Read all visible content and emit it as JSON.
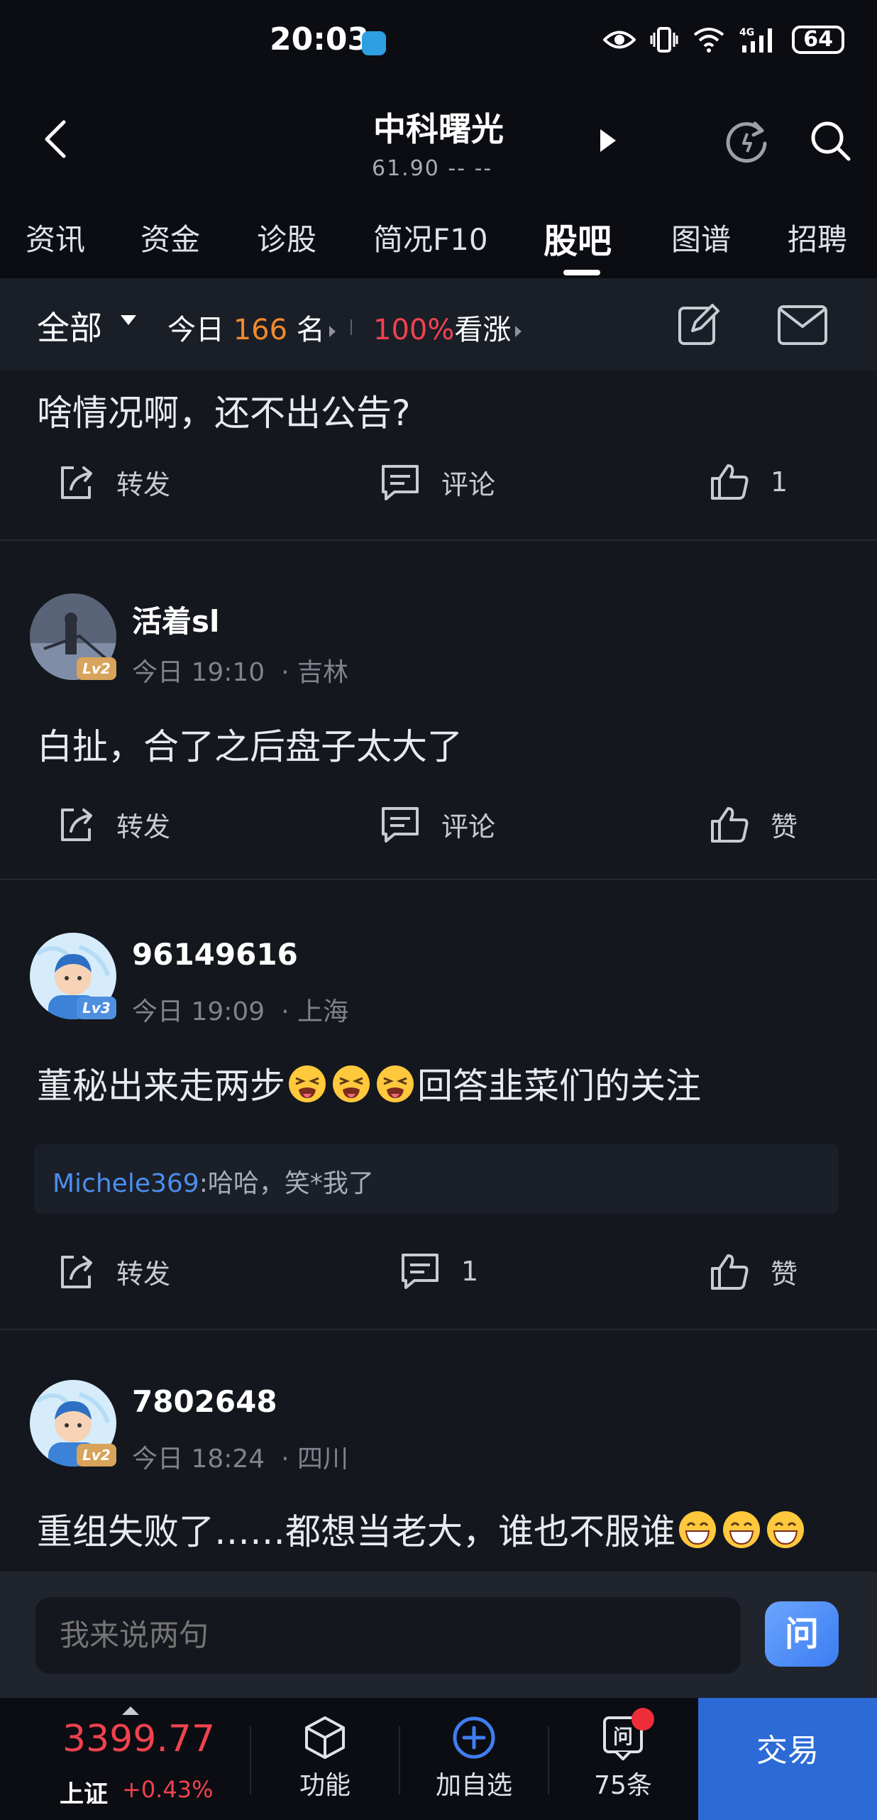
{
  "status_bar": {
    "time": "20:03",
    "battery": "64"
  },
  "header": {
    "stock_name": "中科曙光",
    "price_line": "61.90  --  --"
  },
  "tabs": [
    {
      "label": "资讯"
    },
    {
      "label": "资金"
    },
    {
      "label": "诊股"
    },
    {
      "label": "简况F10"
    },
    {
      "label": "股吧",
      "active": true
    },
    {
      "label": "图谱"
    },
    {
      "label": "招聘"
    }
  ],
  "filter": {
    "scope": "全部",
    "today_prefix": "今日",
    "today_count": "166",
    "today_suffix": "名",
    "bull_pct": "100%",
    "bull_label": "看涨"
  },
  "labels": {
    "forward": "转发",
    "comment": "评论",
    "like": "赞"
  },
  "posts": [
    {
      "content": "啥情况啊，还不出公告?",
      "comments": "评论",
      "likes": "1"
    },
    {
      "username": "活着sl",
      "level": "Lv2",
      "time": "今日 19:10",
      "location": "· 吉林",
      "content": "白扯，合了之后盘子太大了",
      "comments": "评论",
      "likes": "赞"
    },
    {
      "username": "96149616",
      "level": "Lv3",
      "time": "今日 19:09",
      "location": "· 上海",
      "content_before": "董秘出来走两步",
      "content_after": "回答韭菜们的关注",
      "emoji": "tired-face-emoji",
      "reply_user": "Michele369",
      "reply_text": ":哈哈，笑*我了",
      "comments": "1",
      "likes": "赞"
    },
    {
      "username": "7802648",
      "level": "Lv2",
      "time": "今日 18:24",
      "location": "· 四川",
      "content": "重组失败了……都想当老大，谁也不服谁",
      "emoji": "grinning-face-emoji"
    }
  ],
  "comment_bar": {
    "placeholder": "我来说两句",
    "ask_label": "问"
  },
  "bottom": {
    "index_value": "3399.77",
    "index_name": "上证",
    "index_change": "+0.43%",
    "items": [
      {
        "label": "功能",
        "icon": "cube-icon"
      },
      {
        "label": "加自选",
        "icon": "plus-circle-icon"
      },
      {
        "label": "75条",
        "icon": "ask-icon"
      }
    ],
    "trade_label": "交易"
  },
  "colors": {
    "up_red": "#f0424f",
    "accent_orange": "#f08a2a",
    "link_blue": "#4b8ef0",
    "trade_blue": "#2c6bd6"
  }
}
